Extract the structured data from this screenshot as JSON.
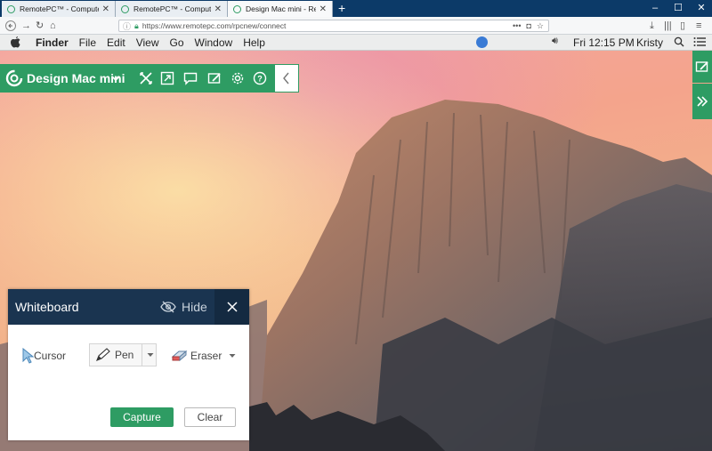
{
  "browser": {
    "tabs": [
      {
        "label": "RemotePC™ - Computers",
        "active": false
      },
      {
        "label": "RemotePC™ - Computers",
        "active": false
      },
      {
        "label": "Design Mac mini - RemotePC™",
        "active": true
      }
    ],
    "new_tab": "+",
    "window_buttons": {
      "minimize": "–",
      "maximize": "☐",
      "close": "✕"
    },
    "url": "https://www.remotepc.com/rpcnew/connect",
    "url_actions": "•••"
  },
  "mac_menu": {
    "apple": "",
    "items": [
      "Finder",
      "File",
      "Edit",
      "View",
      "Go",
      "Window",
      "Help"
    ],
    "clock": "Fri 12:15 PM",
    "user": "Kristy"
  },
  "remote_toolbar": {
    "title": "Design Mac mini"
  },
  "whiteboard": {
    "title": "Whiteboard",
    "hide_label": "Hide",
    "tools": {
      "cursor": "Cursor",
      "pen": "Pen",
      "eraser": "Eraser"
    },
    "capture_label": "Capture",
    "clear_label": "Clear"
  },
  "colors": {
    "accent": "#2e9c63",
    "whiteboard_header": "#1a3450",
    "tabstrip": "#0c3a68"
  }
}
